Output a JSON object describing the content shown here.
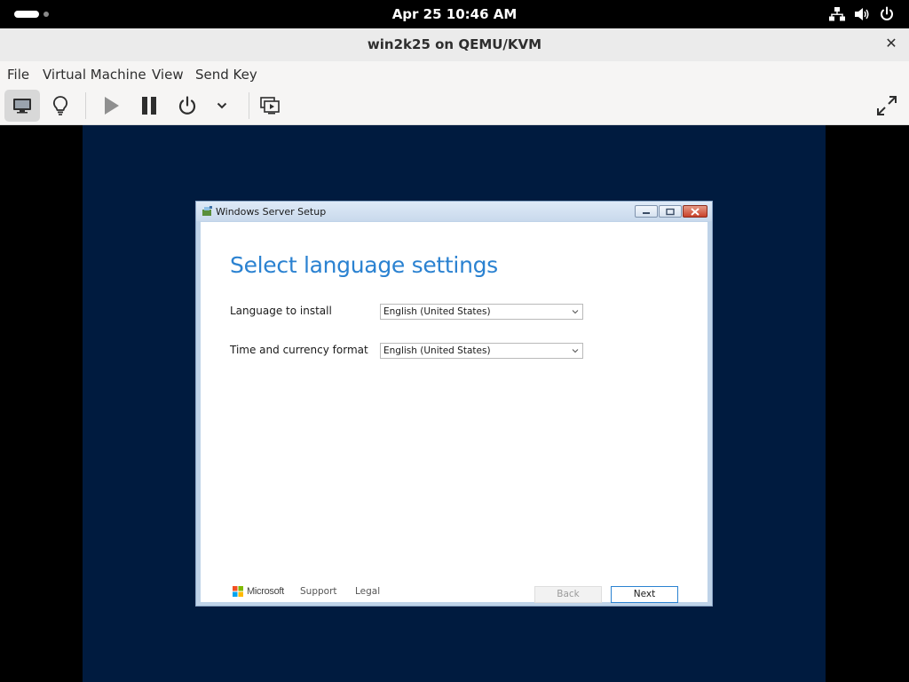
{
  "topbar": {
    "clock": "Apr 25  10:46 AM",
    "icons": [
      "network-icon",
      "volume-icon",
      "power-icon"
    ]
  },
  "window": {
    "title": "win2k25 on QEMU/KVM",
    "close_glyph": "✕"
  },
  "menubar": {
    "items": [
      "File",
      "Virtual Machine",
      "View",
      "Send Key"
    ]
  },
  "toolbar": {
    "buttons": [
      "console-icon",
      "details-icon",
      "run-icon",
      "pause-icon",
      "shutdown-icon",
      "shutdown-menu-icon",
      "snapshots-icon",
      "fullscreen-icon"
    ]
  },
  "setup": {
    "title": "Windows Server Setup",
    "heading": "Select language settings",
    "language_label": "Language to install",
    "language_value": "English (United States)",
    "format_label": "Time and currency format",
    "format_value": "English (United States)",
    "brand": "Microsoft",
    "support_link": "Support",
    "legal_link": "Legal",
    "back_label": "Back",
    "next_label": "Next"
  },
  "colors": {
    "guest_background": "#001b3f",
    "setup_heading": "#2b82d1",
    "ms_red": "#f25022",
    "ms_green": "#7fba00",
    "ms_blue": "#00a4ef",
    "ms_yellow": "#ffb900"
  }
}
